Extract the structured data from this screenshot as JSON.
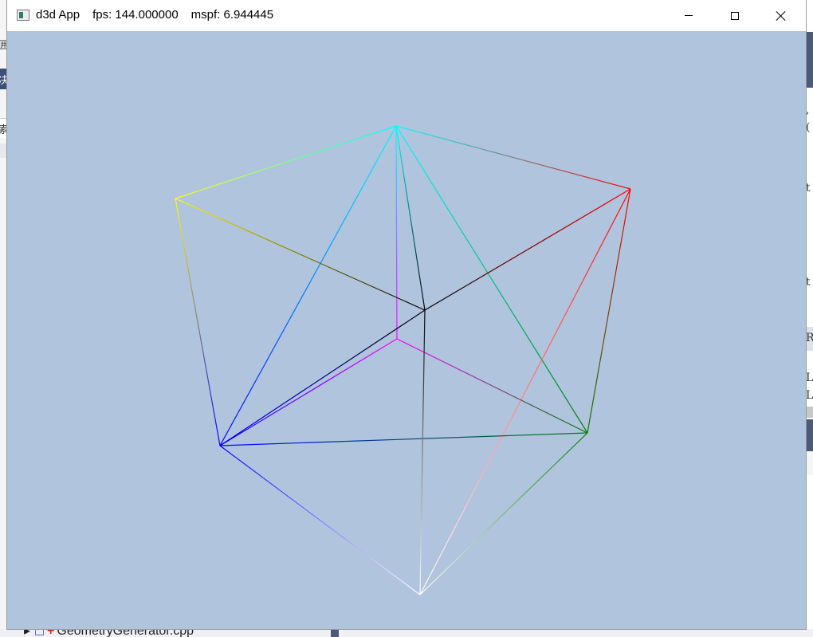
{
  "window": {
    "app_name": "d3d App",
    "fps_text": "fps: 144.000000",
    "mspf_text": "mspf: 6.944445",
    "clear_color": "#b0c4de"
  },
  "controls": {
    "minimize_icon": "minimize-icon",
    "maximize_icon": "maximize-icon",
    "close_icon": "close-icon"
  },
  "scene": {
    "description_type": "wireframe-geometry",
    "vertex_colors": {
      "top": "#00ffff",
      "left": "#ffff00",
      "right": "#ff0000",
      "lower_left": "#0000ff",
      "lower_right": "#008000",
      "bottom": "#ffffff",
      "center": "#000000",
      "inner": "#ff00ff"
    }
  },
  "background_ide": {
    "left_glyphs": [
      "囲",
      "决",
      "索"
    ],
    "right_glyphs": [
      ",",
      "(",
      "t",
      "t",
      "R",
      "L",
      "L"
    ],
    "tree_item": "GeometryGenerator.cpp"
  }
}
